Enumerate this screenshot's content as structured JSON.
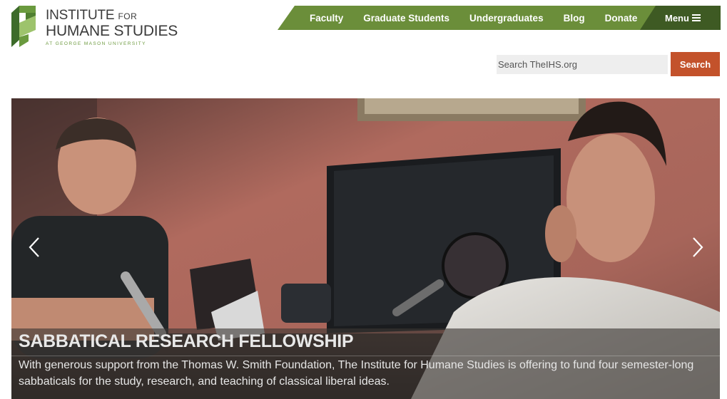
{
  "brand": {
    "line1": "INSTITUTE",
    "line1_small": "FOR",
    "line2": "HUMANE STUDIES",
    "line3": "AT GEORGE MASON UNIVERSITY",
    "colors": {
      "green_dark": "#3d6b2a",
      "green": "#6a9a3e",
      "green_light": "#9dc36c"
    }
  },
  "nav": {
    "items": [
      {
        "label": "Faculty"
      },
      {
        "label": "Graduate Students"
      },
      {
        "label": "Undergraduates"
      },
      {
        "label": "Blog"
      },
      {
        "label": "Donate"
      }
    ],
    "menu_label": "Menu",
    "menu_icon": "hamburger-icon",
    "colors": {
      "bar": "#6b8e3a",
      "menu_bg": "#3e5a23"
    }
  },
  "search": {
    "placeholder": "Search TheIHS.org",
    "value": "",
    "button_label": "Search",
    "button_color": "#c3522b"
  },
  "hero": {
    "title": "SABBATICAL RESEARCH FELLOWSHIP",
    "text": "With generous support from the Thomas W. Smith Foundation, The Institute for Humane Studies is offering to fund four semester-long sabbaticals for the study, research, and teaching of classical liberal ideas.",
    "prev_icon": "chevron-left-icon",
    "next_icon": "chevron-right-icon"
  }
}
